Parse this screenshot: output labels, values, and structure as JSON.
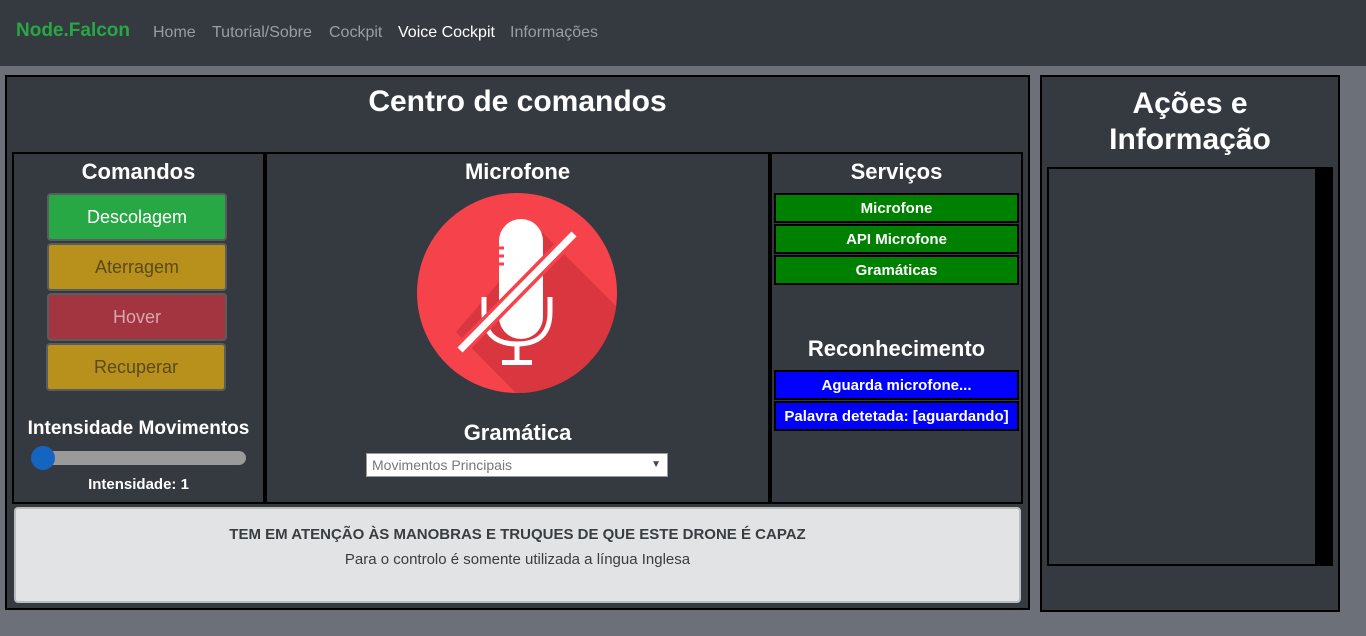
{
  "navbar": {
    "brand": "Node.Falcon",
    "links": [
      "Home",
      "Tutorial/Sobre",
      "Cockpit",
      "Voice Cockpit",
      "Informações"
    ],
    "active": "Voice Cockpit"
  },
  "main": {
    "title": "Centro de comandos",
    "commands": {
      "title": "Comandos",
      "buttons": [
        "Descolagem",
        "Aterragem",
        "Hover",
        "Recuperar"
      ],
      "intensity_title": "Intensidade Movimentos",
      "intensity_label": "Intensidade: 1",
      "intensity_value": 1
    },
    "microphone": {
      "title": "Microfone",
      "grammar_title": "Gramática",
      "grammar_selected": "Movimentos Principais"
    },
    "services": {
      "title": "Serviços",
      "items": [
        "Microfone",
        "API Microfone",
        "Gramáticas"
      ],
      "recognition_title": "Reconhecimento",
      "recognition_items": [
        "Aguarda microfone...",
        "Palavra detetada: [aguardando]"
      ]
    },
    "notice": {
      "heading": "TEM EM ATENÇÃO ÀS MANOBRAS E TRUQUES DE QUE ESTE DRONE É CAPAZ",
      "text": "Para o controlo é somente utilizada a língua Inglesa"
    }
  },
  "side": {
    "title_line1": "Ações e",
    "title_line2": "Informação"
  },
  "colors": {
    "success": "#28a745",
    "warning": "#b8901c",
    "danger": "#a33540",
    "service_ok": "#008000",
    "recognition": "#0000ff",
    "mic_red": "#f5424b"
  }
}
